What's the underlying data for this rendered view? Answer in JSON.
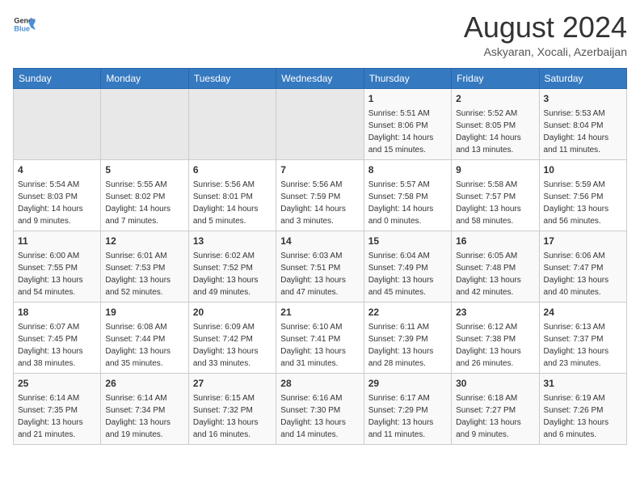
{
  "logo": {
    "line1": "General",
    "line2": "Blue"
  },
  "header": {
    "month_year": "August 2024",
    "location": "Askyaran, Xocali, Azerbaijan"
  },
  "days_of_week": [
    "Sunday",
    "Monday",
    "Tuesday",
    "Wednesday",
    "Thursday",
    "Friday",
    "Saturday"
  ],
  "weeks": [
    [
      {
        "day": "",
        "info": ""
      },
      {
        "day": "",
        "info": ""
      },
      {
        "day": "",
        "info": ""
      },
      {
        "day": "",
        "info": ""
      },
      {
        "day": "1",
        "info": "Sunrise: 5:51 AM\nSunset: 8:06 PM\nDaylight: 14 hours\nand 15 minutes."
      },
      {
        "day": "2",
        "info": "Sunrise: 5:52 AM\nSunset: 8:05 PM\nDaylight: 14 hours\nand 13 minutes."
      },
      {
        "day": "3",
        "info": "Sunrise: 5:53 AM\nSunset: 8:04 PM\nDaylight: 14 hours\nand 11 minutes."
      }
    ],
    [
      {
        "day": "4",
        "info": "Sunrise: 5:54 AM\nSunset: 8:03 PM\nDaylight: 14 hours\nand 9 minutes."
      },
      {
        "day": "5",
        "info": "Sunrise: 5:55 AM\nSunset: 8:02 PM\nDaylight: 14 hours\nand 7 minutes."
      },
      {
        "day": "6",
        "info": "Sunrise: 5:56 AM\nSunset: 8:01 PM\nDaylight: 14 hours\nand 5 minutes."
      },
      {
        "day": "7",
        "info": "Sunrise: 5:56 AM\nSunset: 7:59 PM\nDaylight: 14 hours\nand 3 minutes."
      },
      {
        "day": "8",
        "info": "Sunrise: 5:57 AM\nSunset: 7:58 PM\nDaylight: 14 hours\nand 0 minutes."
      },
      {
        "day": "9",
        "info": "Sunrise: 5:58 AM\nSunset: 7:57 PM\nDaylight: 13 hours\nand 58 minutes."
      },
      {
        "day": "10",
        "info": "Sunrise: 5:59 AM\nSunset: 7:56 PM\nDaylight: 13 hours\nand 56 minutes."
      }
    ],
    [
      {
        "day": "11",
        "info": "Sunrise: 6:00 AM\nSunset: 7:55 PM\nDaylight: 13 hours\nand 54 minutes."
      },
      {
        "day": "12",
        "info": "Sunrise: 6:01 AM\nSunset: 7:53 PM\nDaylight: 13 hours\nand 52 minutes."
      },
      {
        "day": "13",
        "info": "Sunrise: 6:02 AM\nSunset: 7:52 PM\nDaylight: 13 hours\nand 49 minutes."
      },
      {
        "day": "14",
        "info": "Sunrise: 6:03 AM\nSunset: 7:51 PM\nDaylight: 13 hours\nand 47 minutes."
      },
      {
        "day": "15",
        "info": "Sunrise: 6:04 AM\nSunset: 7:49 PM\nDaylight: 13 hours\nand 45 minutes."
      },
      {
        "day": "16",
        "info": "Sunrise: 6:05 AM\nSunset: 7:48 PM\nDaylight: 13 hours\nand 42 minutes."
      },
      {
        "day": "17",
        "info": "Sunrise: 6:06 AM\nSunset: 7:47 PM\nDaylight: 13 hours\nand 40 minutes."
      }
    ],
    [
      {
        "day": "18",
        "info": "Sunrise: 6:07 AM\nSunset: 7:45 PM\nDaylight: 13 hours\nand 38 minutes."
      },
      {
        "day": "19",
        "info": "Sunrise: 6:08 AM\nSunset: 7:44 PM\nDaylight: 13 hours\nand 35 minutes."
      },
      {
        "day": "20",
        "info": "Sunrise: 6:09 AM\nSunset: 7:42 PM\nDaylight: 13 hours\nand 33 minutes."
      },
      {
        "day": "21",
        "info": "Sunrise: 6:10 AM\nSunset: 7:41 PM\nDaylight: 13 hours\nand 31 minutes."
      },
      {
        "day": "22",
        "info": "Sunrise: 6:11 AM\nSunset: 7:39 PM\nDaylight: 13 hours\nand 28 minutes."
      },
      {
        "day": "23",
        "info": "Sunrise: 6:12 AM\nSunset: 7:38 PM\nDaylight: 13 hours\nand 26 minutes."
      },
      {
        "day": "24",
        "info": "Sunrise: 6:13 AM\nSunset: 7:37 PM\nDaylight: 13 hours\nand 23 minutes."
      }
    ],
    [
      {
        "day": "25",
        "info": "Sunrise: 6:14 AM\nSunset: 7:35 PM\nDaylight: 13 hours\nand 21 minutes."
      },
      {
        "day": "26",
        "info": "Sunrise: 6:14 AM\nSunset: 7:34 PM\nDaylight: 13 hours\nand 19 minutes."
      },
      {
        "day": "27",
        "info": "Sunrise: 6:15 AM\nSunset: 7:32 PM\nDaylight: 13 hours\nand 16 minutes."
      },
      {
        "day": "28",
        "info": "Sunrise: 6:16 AM\nSunset: 7:30 PM\nDaylight: 13 hours\nand 14 minutes."
      },
      {
        "day": "29",
        "info": "Sunrise: 6:17 AM\nSunset: 7:29 PM\nDaylight: 13 hours\nand 11 minutes."
      },
      {
        "day": "30",
        "info": "Sunrise: 6:18 AM\nSunset: 7:27 PM\nDaylight: 13 hours\nand 9 minutes."
      },
      {
        "day": "31",
        "info": "Sunrise: 6:19 AM\nSunset: 7:26 PM\nDaylight: 13 hours\nand 6 minutes."
      }
    ]
  ]
}
